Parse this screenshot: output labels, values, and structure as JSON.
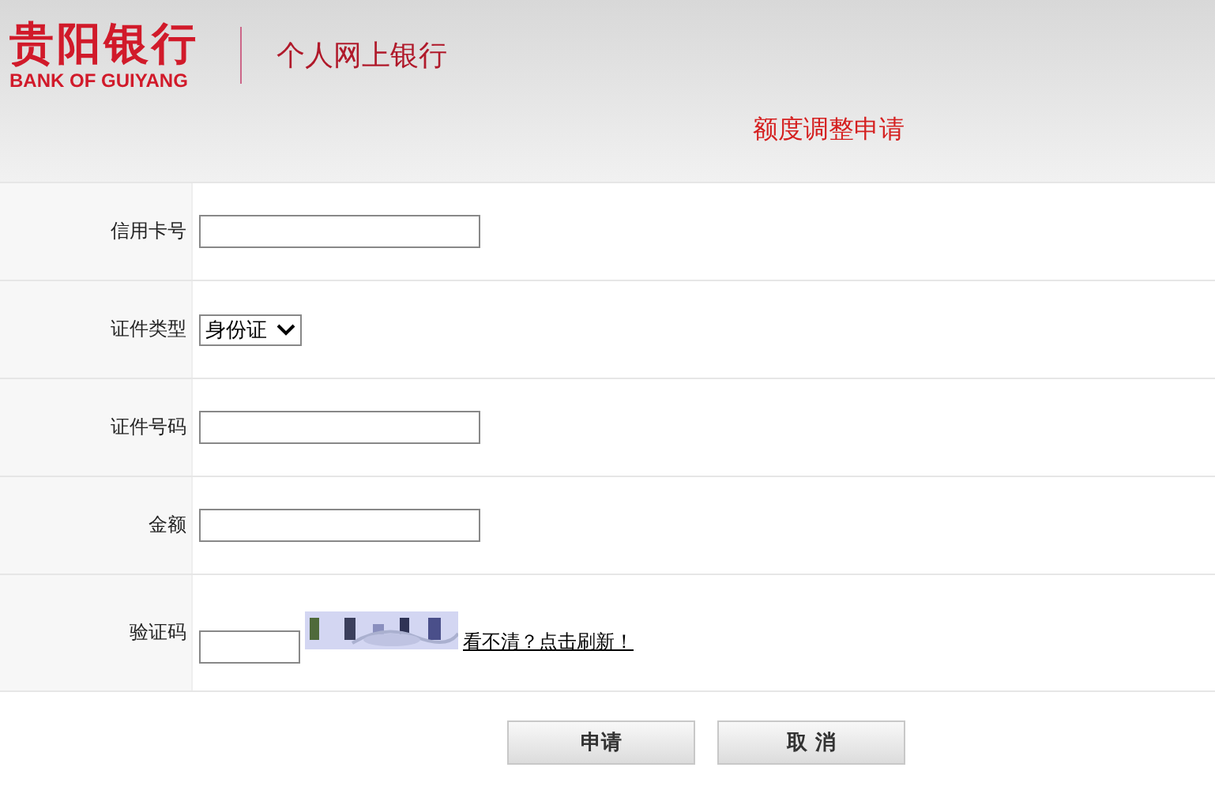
{
  "header": {
    "logo_cn": "贵阳银行",
    "logo_en": "BANK OF GUIYANG",
    "site_title": "个人网上银行",
    "page_title": "额度调整申请"
  },
  "fields": [
    {
      "label": "信用卡号",
      "kind": "text"
    },
    {
      "label": "证件类型",
      "kind": "select",
      "value": "身份证"
    },
    {
      "label": "证件号码",
      "kind": "text"
    },
    {
      "label": "金额",
      "kind": "text"
    },
    {
      "label": "验证码",
      "kind": "captcha",
      "refresh_link": "看不清？点击刷新！"
    }
  ],
  "buttons": [
    "申请",
    "取 消"
  ]
}
